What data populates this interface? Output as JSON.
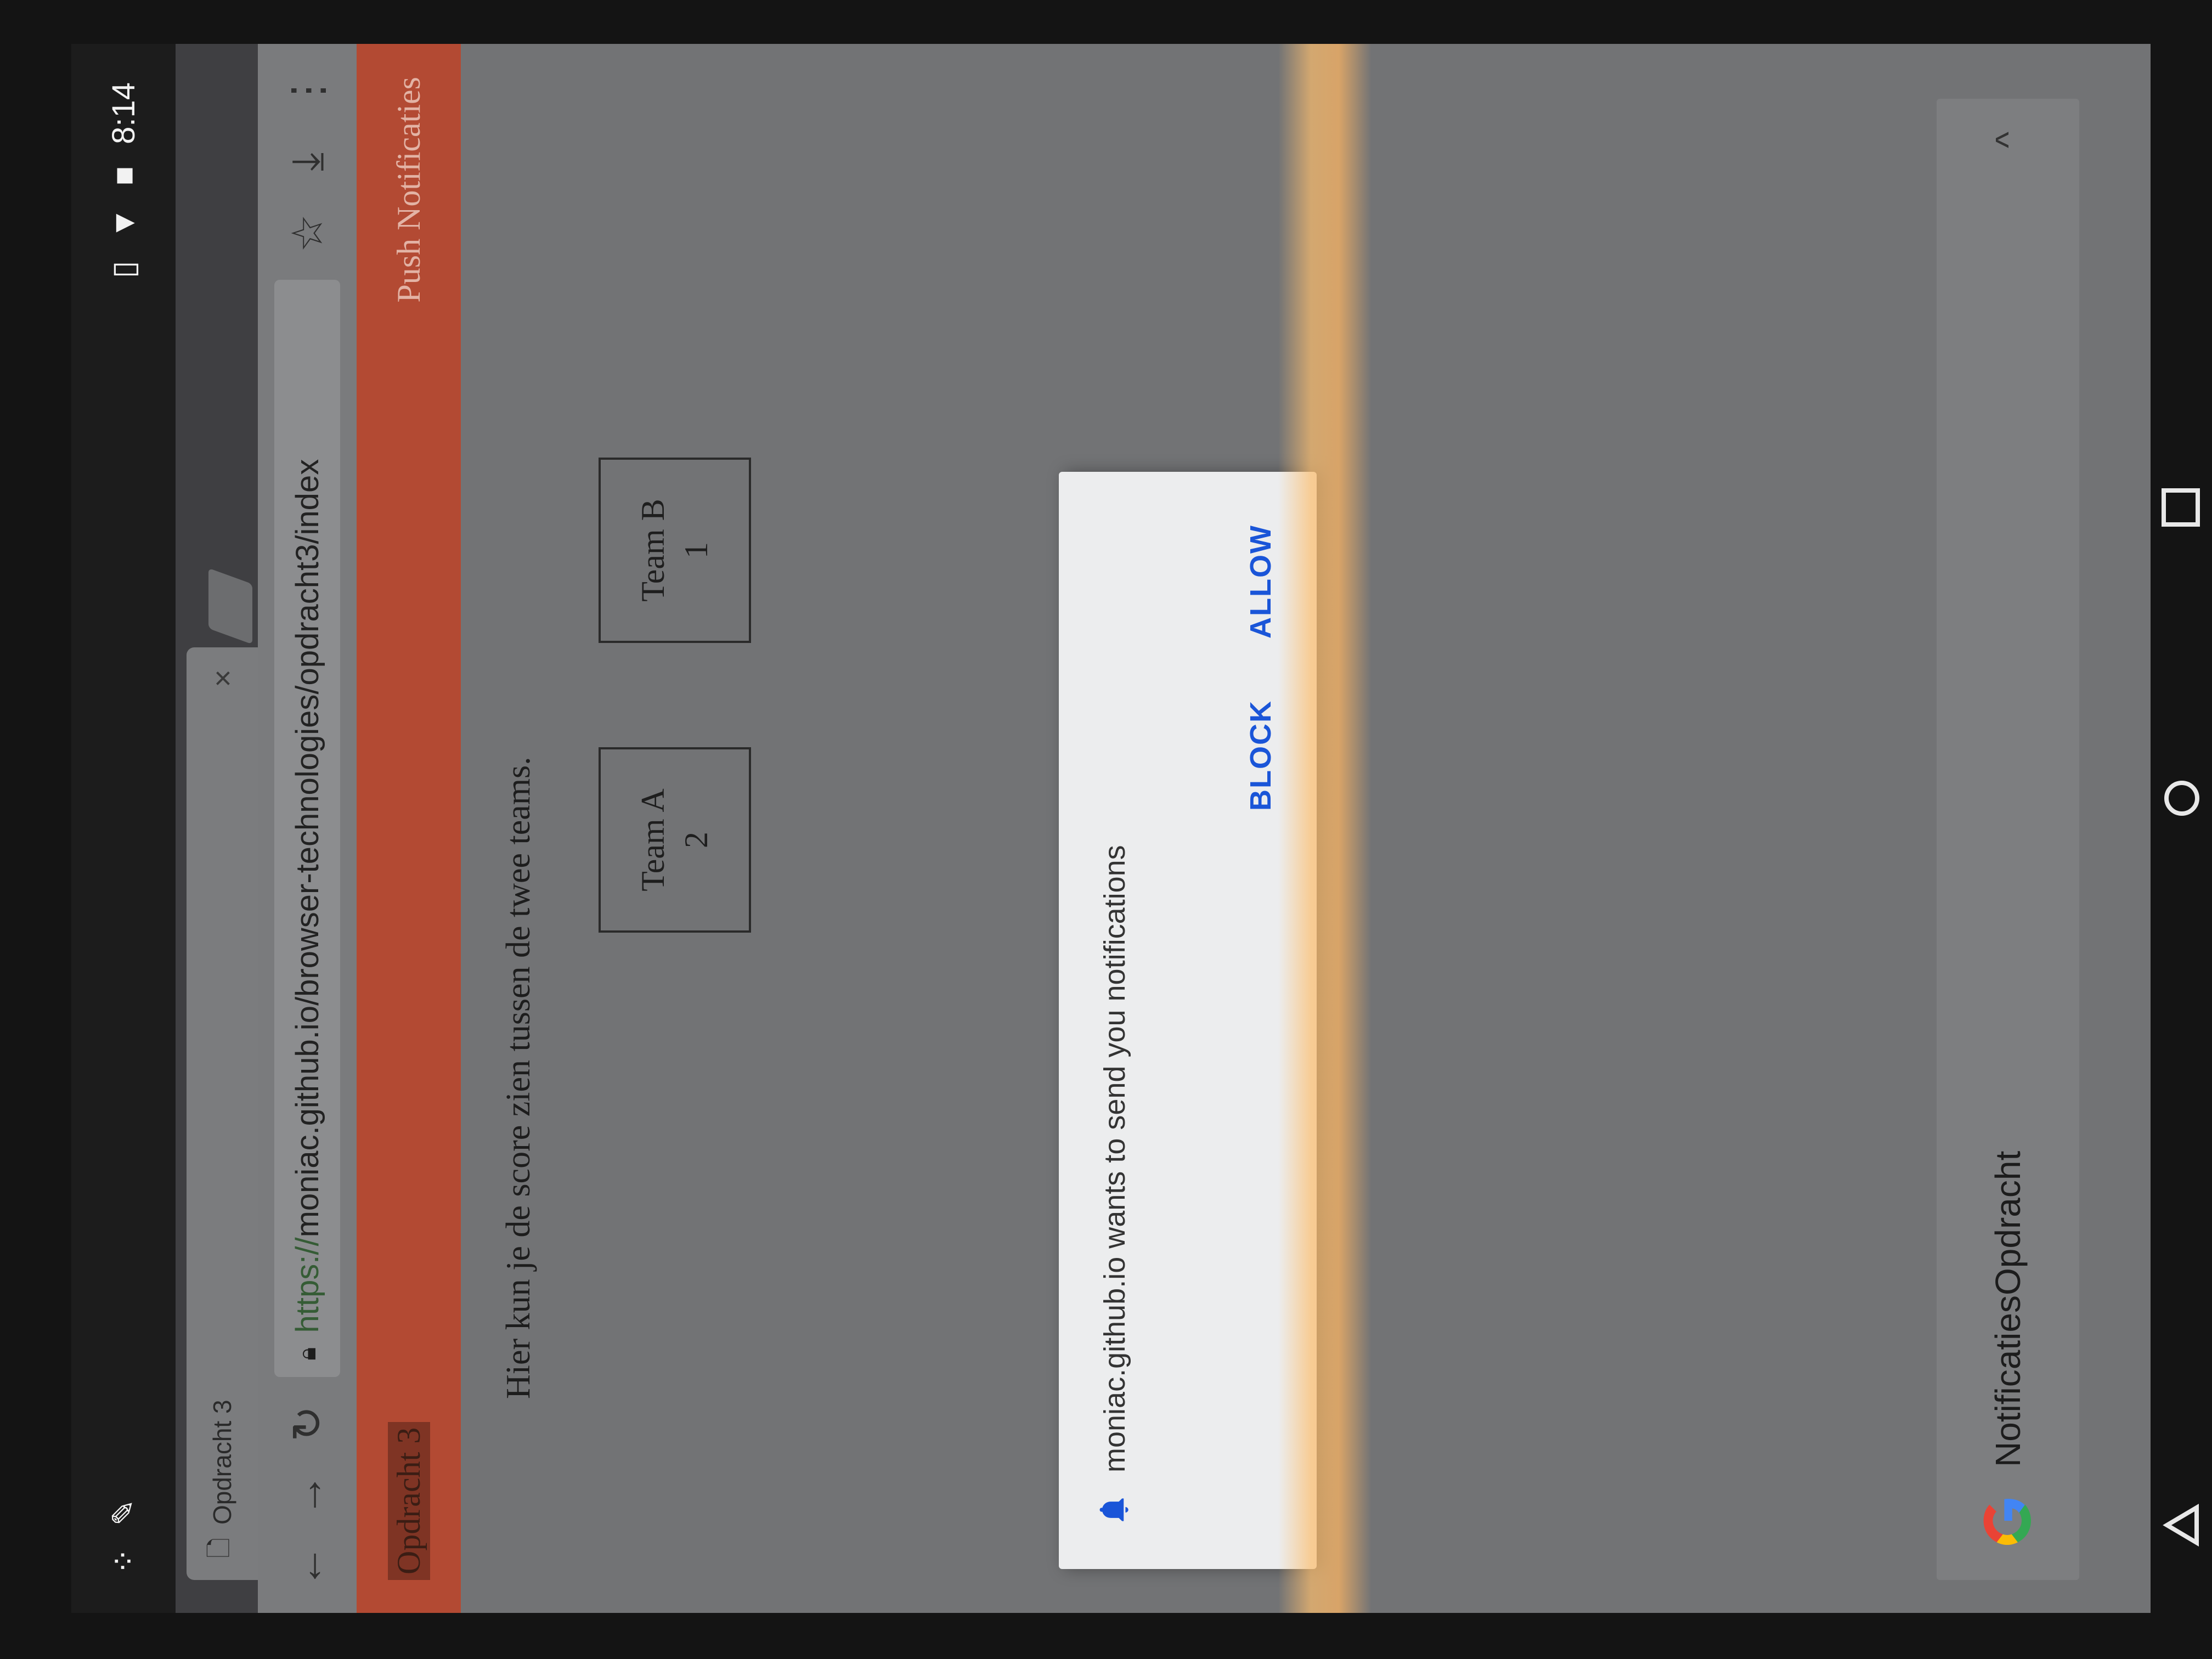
{
  "status_bar": {
    "time": "8:14",
    "icons": [
      "assistant-icon",
      "notification-icon",
      "vibrate-icon",
      "wifi-icon",
      "battery-icon"
    ]
  },
  "tab": {
    "title": "Opdracht 3",
    "close_glyph": "×"
  },
  "toolbar": {
    "url_scheme": "https://",
    "url_rest": "moniac.github.io/browser-technologies/opdracht3/index",
    "icons": [
      "back-icon",
      "forward-icon",
      "reload-icon",
      "lock-icon",
      "star-icon",
      "download-icon",
      "menu-icon"
    ]
  },
  "page": {
    "header_title": "Opdracht 3",
    "header_link": "Push Notificaties",
    "intro": "Hier kun je de score zien tussen de twee teams.",
    "teams": [
      {
        "name": "Team A",
        "score": "2"
      },
      {
        "name": "Team B",
        "score": "1"
      }
    ],
    "header_color": "#b34a33"
  },
  "dialog": {
    "message": "moniac.github.io wants to send you notifications",
    "block_label": "BLOCK",
    "allow_label": "ALLOW",
    "accent_color": "#1a55d8"
  },
  "suggestion": {
    "text": "NotificatiesOpdracht",
    "chevron": "^"
  }
}
